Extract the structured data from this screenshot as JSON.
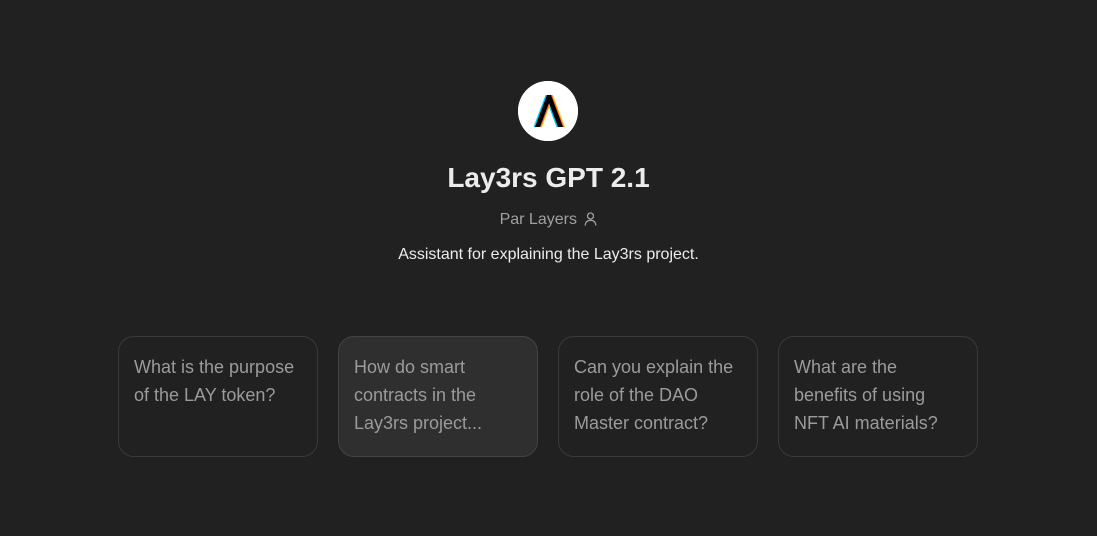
{
  "gpt": {
    "logo_icon": "lay3rs-logo-icon",
    "name": "Lay3rs GPT 2.1",
    "byline": "Par Layers",
    "author_icon": "person-icon",
    "description": "Assistant for explaining the Lay3rs project."
  },
  "conversation_starters": [
    {
      "label": "What is the purpose of the LAY token?"
    },
    {
      "label": "How do smart contracts in the Lay3rs project..."
    },
    {
      "label": "Can you explain the role of the DAO Master contract?"
    },
    {
      "label": "What are the benefits of using NFT AI materials?"
    }
  ],
  "colors": {
    "background": "#212121",
    "card_hover": "#2f2f2f",
    "card_border": "#3a3a3a",
    "text_primary": "#ececec",
    "text_muted": "#9b9b9b"
  }
}
